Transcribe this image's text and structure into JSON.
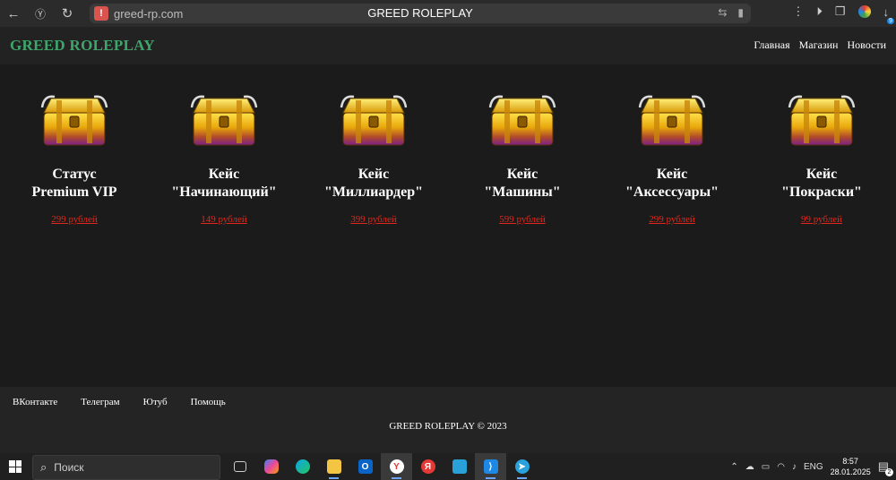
{
  "browser": {
    "url": "greed-rp.com",
    "tab_title": "GREED ROLEPLAY"
  },
  "site": {
    "logo": "GREED ROLEPLAY",
    "nav": [
      "Главная",
      "Магазин",
      "Новости"
    ]
  },
  "products": [
    {
      "title_line1": "Статус",
      "title_line2": "Premium VIP",
      "price": "299 рублей"
    },
    {
      "title_line1": "Кейс",
      "title_line2": "\"Начинающий\"",
      "price": "149 рублей"
    },
    {
      "title_line1": "Кейс",
      "title_line2": "\"Миллиардер\"",
      "price": "399 рублей"
    },
    {
      "title_line1": "Кейс",
      "title_line2": "\"Машины\"",
      "price": "599 рублей"
    },
    {
      "title_line1": "Кейс",
      "title_line2": "\"Аксессуары\"",
      "price": "299 рублей"
    },
    {
      "title_line1": "Кейс",
      "title_line2": "\"Покраски\"",
      "price": "99 рублей"
    }
  ],
  "footer": {
    "links": [
      "ВКонтакте",
      "Телеграм",
      "Ютуб",
      "Помощь"
    ],
    "copyright": "GREED ROLEPLAY © 2023"
  },
  "taskbar": {
    "search_placeholder": "Поиск",
    "language": "ENG",
    "time": "8:57",
    "date": "28.01.2025",
    "notification_count": "2",
    "download_count": "9"
  },
  "colors": {
    "logo": "#3fa66b",
    "price": "#e0281e",
    "page_bg": "#1b1b1b"
  }
}
